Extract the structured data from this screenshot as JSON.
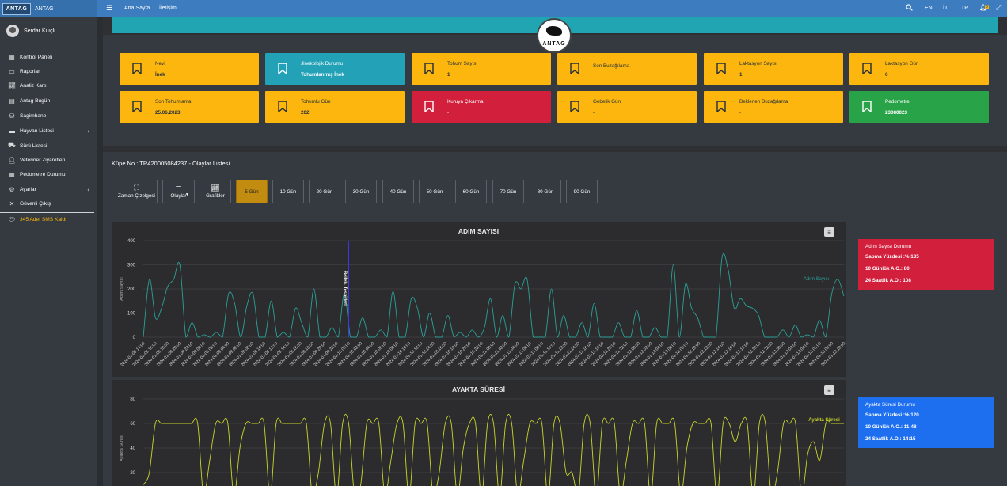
{
  "brand": {
    "logo_text": "ANTAG",
    "name": "ANTAG"
  },
  "topnav": {
    "home": "Ana Sayfa",
    "contact": "İletişim",
    "lang_en": "EN",
    "lang_it": "İT",
    "lang_tr": "TR",
    "notif_count": "0"
  },
  "user": {
    "name": "Serdar Kılıçlı"
  },
  "sidebar": {
    "items": [
      {
        "label": "Kontrol Paneli",
        "icon": "dashboard-icon"
      },
      {
        "label": "Raporlar",
        "icon": "report-icon"
      },
      {
        "label": "Analiz Kartı",
        "icon": "chart-icon"
      },
      {
        "label": "Antag Bugün",
        "icon": "calendar-icon"
      },
      {
        "label": "Sagimhane",
        "icon": "milk-icon"
      },
      {
        "label": "Hayvan Listesi",
        "icon": "list-icon"
      },
      {
        "label": "Sürü Listesi",
        "icon": "truck-icon"
      },
      {
        "label": "Veteriner Ziyaretleri",
        "icon": "user-icon"
      },
      {
        "label": "Pedometre Durumu",
        "icon": "table-icon"
      },
      {
        "label": "Ayarlar",
        "icon": "gear-icon"
      },
      {
        "label": "Güvenli Çıkış",
        "icon": "close-icon"
      }
    ],
    "sms": "345 Adet SMS Kaldı"
  },
  "logo_circle": {
    "text": "ANTAG"
  },
  "cards": [
    {
      "label": "Nevi",
      "value": "İnek",
      "color": "#fdb60d"
    },
    {
      "label": "Jinekolojik Durumu",
      "value": "Tohumlanmış İnek",
      "color": "#23a1b6"
    },
    {
      "label": "Tohum Sayısı",
      "value": "1",
      "color": "#fdb60d"
    },
    {
      "label": "Son Buzağılama",
      "value": "",
      "color": "#fdb60d"
    },
    {
      "label": "Laktasyon Sayısı",
      "value": "1",
      "color": "#fdb60d"
    },
    {
      "label": "Laktasyon Gün",
      "value": "0",
      "color": "#fdb60d"
    },
    {
      "label": "Son Tohumlama",
      "value": "25.06.2023",
      "color": "#fdb60d"
    },
    {
      "label": "Tohumlu Gün",
      "value": "202",
      "color": "#fdb60d"
    },
    {
      "label": "Kuruya Çıkarma",
      "value": "-",
      "color": "#d21f3c"
    },
    {
      "label": "Gebelik Gün",
      "value": "-",
      "color": "#fdb60d"
    },
    {
      "label": "Beklenen Buzağılama",
      "value": "-",
      "color": "#fdb60d"
    },
    {
      "label": "Pedometre",
      "value": "23080023",
      "color": "#28a347"
    }
  ],
  "events": {
    "title": "Küpe No : TR420005084237 - Olaylar Listesi",
    "buttons": [
      "Zaman Çizelgesi",
      "Olaylar",
      "Grafikler",
      "5 Gün",
      "10 Gün",
      "20 Gün",
      "30 Gün",
      "40 Gün",
      "50 Gün",
      "60 Gün",
      "70 Gün",
      "80 Gün",
      "90 Gün"
    ]
  },
  "info_steps": {
    "title": "Adım Sayısı Durumu",
    "deviation": "Sapma Yüzdesi :% 135",
    "avg10": "10 Günlük A.O.: 80",
    "avg24": "24 Saatlik A.O.: 108",
    "color": "#d21f3c"
  },
  "info_standing": {
    "title": "Ayakta Süresi Durumu",
    "deviation": "Sapma Yüzdesi :% 120",
    "avg10": "10 Günlük A.O.: 11:48",
    "avg24": "24 Saatlik A.O.: 14:15",
    "color": "#1e6ff0"
  },
  "chart_data": [
    {
      "type": "line",
      "title": "ADIM SAYISI",
      "ylabel": "Adım Sayısı",
      "ylim": [
        0,
        400
      ],
      "yticks": [
        0,
        100,
        200,
        300,
        400
      ],
      "legend_position": "right",
      "annotation": {
        "label": "Belleb. Tespitleri",
        "x": "2024-01-10 00:00"
      },
      "series": [
        {
          "name": "Adım Sayısı",
          "color": "#2aa198",
          "values": [
            0,
            240,
            80,
            120,
            210,
            240,
            300,
            0,
            60,
            0,
            10,
            0,
            20,
            0,
            180,
            140,
            0,
            130,
            180,
            0,
            0,
            150,
            0,
            20,
            0,
            120,
            60,
            0,
            200,
            0,
            0,
            40,
            0,
            180,
            0,
            0,
            80,
            0,
            0,
            30,
            0,
            190,
            0,
            0,
            160,
            120,
            0,
            100,
            0,
            0,
            90,
            0,
            20,
            0,
            30,
            0,
            40,
            160,
            0,
            90,
            0,
            220,
            200,
            240,
            0,
            0,
            0,
            200,
            0,
            90,
            0,
            0,
            60,
            0,
            140,
            0,
            0,
            0,
            60,
            0,
            0,
            110,
            0,
            0,
            40,
            0,
            0,
            300,
            0,
            220,
            120,
            80,
            0,
            0,
            0,
            330,
            280,
            120,
            160,
            130,
            120,
            90,
            0,
            0,
            0,
            30,
            0,
            50,
            0,
            10,
            0,
            70,
            0,
            180,
            240,
            170
          ]
        }
      ],
      "x_labels": [
        "2024-01-09 14:00",
        "2024-01-09 16:00",
        "2024-01-09 18:00",
        "2024-01-09 20:00",
        "2024-01-09 22:00",
        "2024-01-09 00:00",
        "2024-01-09 02:00",
        "2024-01-09 04:00",
        "2024-01-09 06:00",
        "2024-01-09 08:00",
        "2024-01-09 10:00",
        "2024-01-09 12:00",
        "2024-01-09 14:00",
        "2024-01-09 16:00",
        "2024-01-09 18:00",
        "2024-01-09 20:00",
        "2024-01-09 22:00",
        "2024-01-10 00:00",
        "2024-01-10 02:00",
        "2024-01-10 04:00",
        "2024-01-10 06:00",
        "2024-01-10 08:00",
        "2024-01-10 10:00",
        "2024-01-10 12:00",
        "2024-01-10 14:00",
        "2024-01-10 16:00",
        "2024-01-10 18:00",
        "2024-01-10 20:00",
        "2024-01-10 22:00",
        "2024-01-11 00:00",
        "2024-01-11 02:00",
        "2024-01-11 04:00",
        "2024-01-11 06:00",
        "2024-01-11 08:00",
        "2024-01-11 10:00",
        "2024-01-11 12:00",
        "2024-01-11 14:00",
        "2024-01-11 16:00",
        "2024-01-11 18:00",
        "2024-01-11 20:00",
        "2024-01-11 22:00",
        "2024-01-12 00:00",
        "2024-01-12 02:00",
        "2024-01-12 04:00",
        "2024-01-12 06:00",
        "2024-01-12 08:00",
        "2024-01-12 10:00",
        "2024-01-12 12:00",
        "2024-01-12 14:00",
        "2024-01-12 16:00",
        "2024-01-12 18:00",
        "2024-01-12 20:00",
        "2024-01-12 22:00",
        "2024-01-13 00:00",
        "2024-01-13 02:00",
        "2024-01-13 04:00",
        "2024-01-13 06:00",
        "2024-01-13 08:00",
        "2024-01-13 10:00"
      ]
    },
    {
      "type": "line",
      "title": "AYAKTA SÜRESİ",
      "ylabel": "Ayakta Süresi",
      "ylim": [
        0,
        80
      ],
      "yticks": [
        20,
        40,
        60,
        80
      ],
      "legend_position": "top-right",
      "series": [
        {
          "name": "Ayakta Süresi",
          "color": "#c8d62b",
          "values": [
            10,
            20,
            60,
            60,
            60,
            60,
            60,
            60,
            60,
            60,
            0,
            30,
            60,
            60,
            60,
            0,
            40,
            60,
            60,
            60,
            60,
            0,
            60,
            60,
            60,
            60,
            60,
            60,
            0,
            20,
            60,
            60,
            0,
            60,
            60,
            0,
            10,
            60,
            60,
            60,
            0,
            30,
            60,
            60,
            0,
            60,
            60,
            60,
            0,
            20,
            60,
            60,
            0,
            40,
            60,
            60,
            0,
            60,
            60,
            0,
            60,
            60,
            0,
            30,
            60,
            60,
            60,
            0,
            60,
            60,
            20,
            20,
            0,
            60,
            60,
            0,
            60,
            60,
            60,
            0,
            30,
            60,
            60,
            60,
            0,
            60,
            60,
            60,
            60,
            0,
            40,
            60,
            60,
            60,
            60,
            0,
            60,
            60,
            45,
            60,
            60,
            0,
            60,
            60,
            0,
            20,
            60,
            60,
            60,
            0,
            35,
            45,
            30,
            60,
            60,
            60,
            60
          ]
        }
      ]
    }
  ]
}
